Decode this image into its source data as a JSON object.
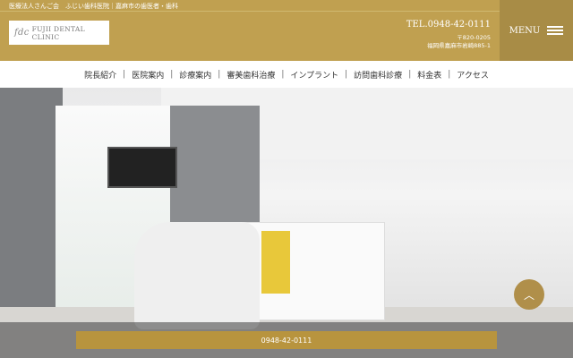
{
  "header": {
    "tagline": "医療法人さんご会　ふじい歯科医院｜嘉麻市の歯医者・歯科",
    "logo_text": "FUJII DENTAL CLINIC",
    "logo_mark": "fdc",
    "tel": "TEL.0948-42-0111",
    "postal": "〒820-0205",
    "address": "福岡県嘉麻市岩崎885-1",
    "menu_label": "MENU"
  },
  "nav": [
    "院長紹介",
    "医院案内",
    "診療案内",
    "審美歯科治療",
    "インプラント",
    "訪問歯科診療",
    "料金表",
    "アクセス"
  ],
  "nav_separator": "|",
  "bottom": {
    "tel_button": "0948-42-0111"
  },
  "colors": {
    "gold": "#c0a050",
    "menu_bg": "#a88c46"
  }
}
